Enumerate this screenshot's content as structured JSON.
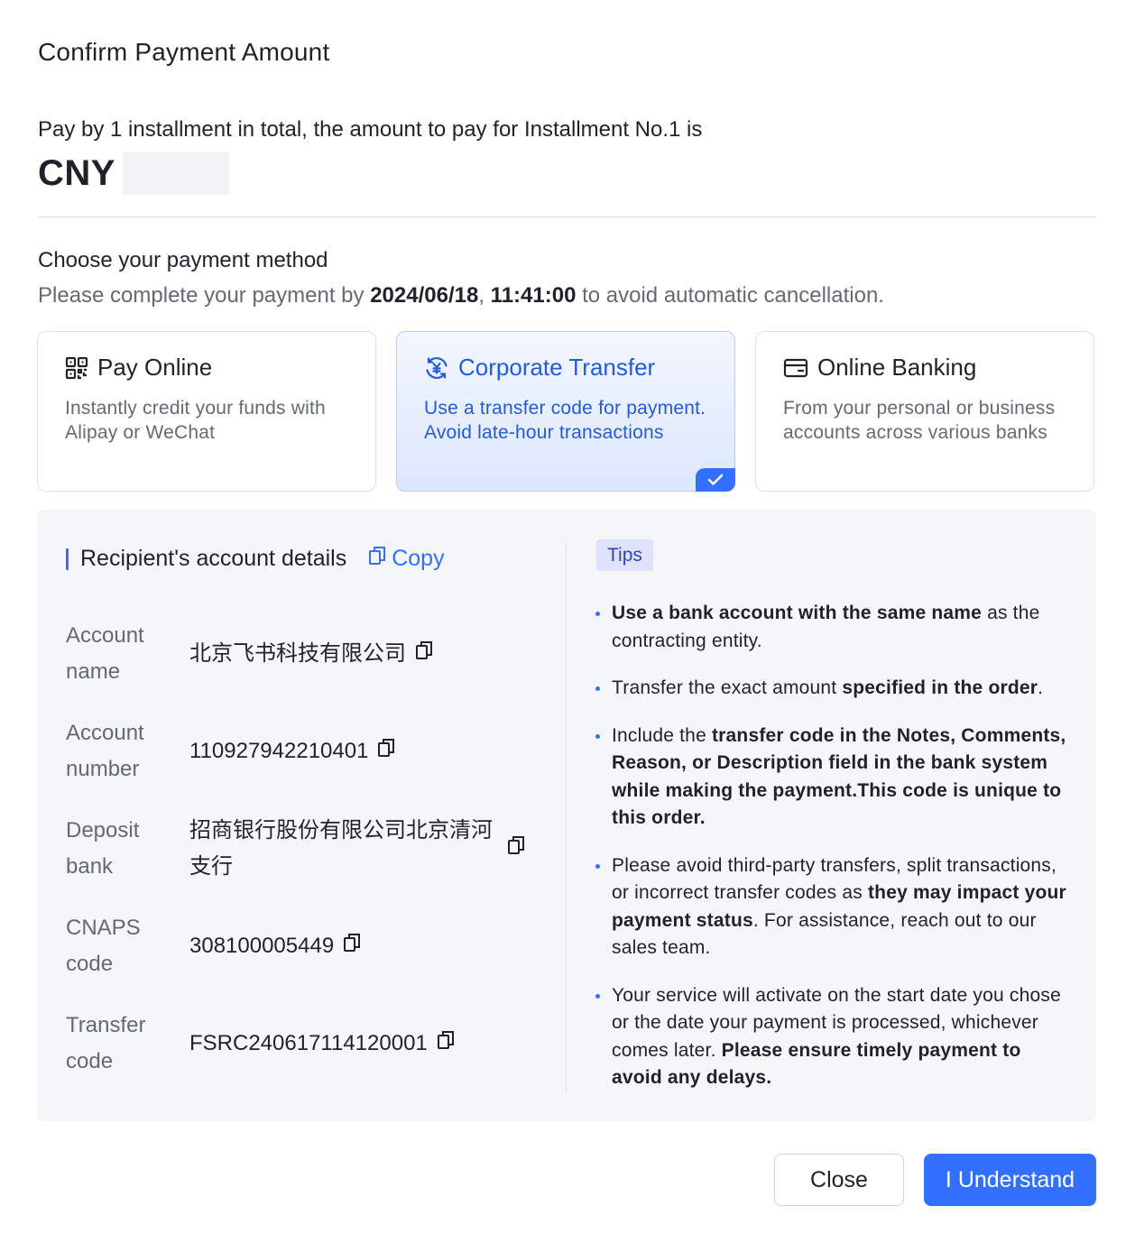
{
  "dialog": {
    "title": "Confirm Payment Amount",
    "installment_text": "Pay by 1 installment in total, the amount to pay for Installment No.1 is",
    "currency": "CNY"
  },
  "payment_method": {
    "heading": "Choose your payment method",
    "deadline_prefix": "Please complete your payment by",
    "deadline_date": "2024/06/18",
    "deadline_sep": ",",
    "deadline_time": "11:41:00",
    "deadline_suffix": "to avoid automatic cancellation.",
    "selected": "Corporate Transfer",
    "options": [
      {
        "label": "Pay Online",
        "description": "Instantly credit your funds with Alipay or WeChat",
        "icon": "qr-code-icon"
      },
      {
        "label": "Corporate Transfer",
        "description": "Use a transfer code for payment. Avoid late-hour transactions",
        "icon": "yen-exchange-icon"
      },
      {
        "label": "Online Banking",
        "description": "From your personal or business accounts across various banks",
        "icon": "credit-card-icon"
      }
    ]
  },
  "recipient": {
    "title": "Recipient's account details",
    "copy_label": "Copy",
    "rows": [
      {
        "label": "Account name",
        "value": "北京飞书科技有限公司"
      },
      {
        "label": "Account number",
        "value": "110927942210401"
      },
      {
        "label": "Deposit bank",
        "value": "招商银行股份有限公司北京清河支行"
      },
      {
        "label": "CNAPS code",
        "value": "308100005449"
      },
      {
        "label": "Transfer code",
        "value": "FSRC240617114120001"
      }
    ]
  },
  "tips": {
    "badge": "Tips",
    "items": [
      [
        {
          "b": "Use a bank account with the same name"
        },
        {
          "t": " as the contracting entity."
        }
      ],
      [
        {
          "t": "Transfer the exact amount "
        },
        {
          "b": "specified in the order"
        },
        {
          "t": "."
        }
      ],
      [
        {
          "t": "Include the "
        },
        {
          "b": "transfer code in the Notes, Comments, Reason, or Description field in the bank system while making the payment.This code is unique to this order."
        }
      ],
      [
        {
          "t": "Please avoid third-party transfers, split transactions, or incorrect transfer codes as "
        },
        {
          "b": "they may impact your payment status"
        },
        {
          "t": ". For assistance, reach out to our sales team."
        }
      ],
      [
        {
          "t": "Your service will activate on the start date you chose or the date your payment is processed, whichever comes later. "
        },
        {
          "b": "Please ensure timely payment to avoid any delays."
        }
      ]
    ]
  },
  "footer": {
    "close_label": "Close",
    "confirm_label": "I Understand"
  },
  "colors": {
    "accent": "#3370ff",
    "selected_text": "#245bdb",
    "muted_text": "#646a73"
  }
}
